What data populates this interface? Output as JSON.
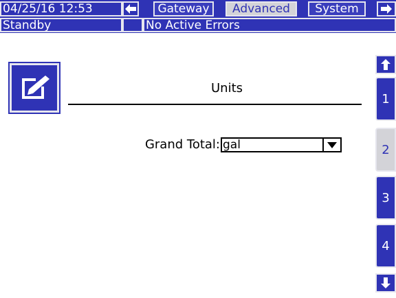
{
  "header": {
    "datetime": "04/25/16 12:53",
    "tabs": [
      {
        "label": "Gateway",
        "active": false
      },
      {
        "label": "Advanced",
        "active": true
      },
      {
        "label": "System",
        "active": false
      }
    ],
    "nav_left_icon": "left-arrow-icon",
    "nav_right_icon": "right-arrow-icon"
  },
  "status": {
    "state": "Standby",
    "errors": "No Active Errors"
  },
  "main": {
    "edit_icon": "edit-icon",
    "title": "Units",
    "fields": [
      {
        "label": "Grand Total:",
        "value": "gal"
      }
    ]
  },
  "pages": {
    "up_icon": "up-arrow-icon",
    "down_icon": "down-arrow-icon",
    "items": [
      "1",
      "2",
      "3",
      "4"
    ],
    "active": "2"
  },
  "colors": {
    "primary": "#2f33b5",
    "active_tab": "#d3d3d8",
    "border": "#e6e6ee"
  }
}
